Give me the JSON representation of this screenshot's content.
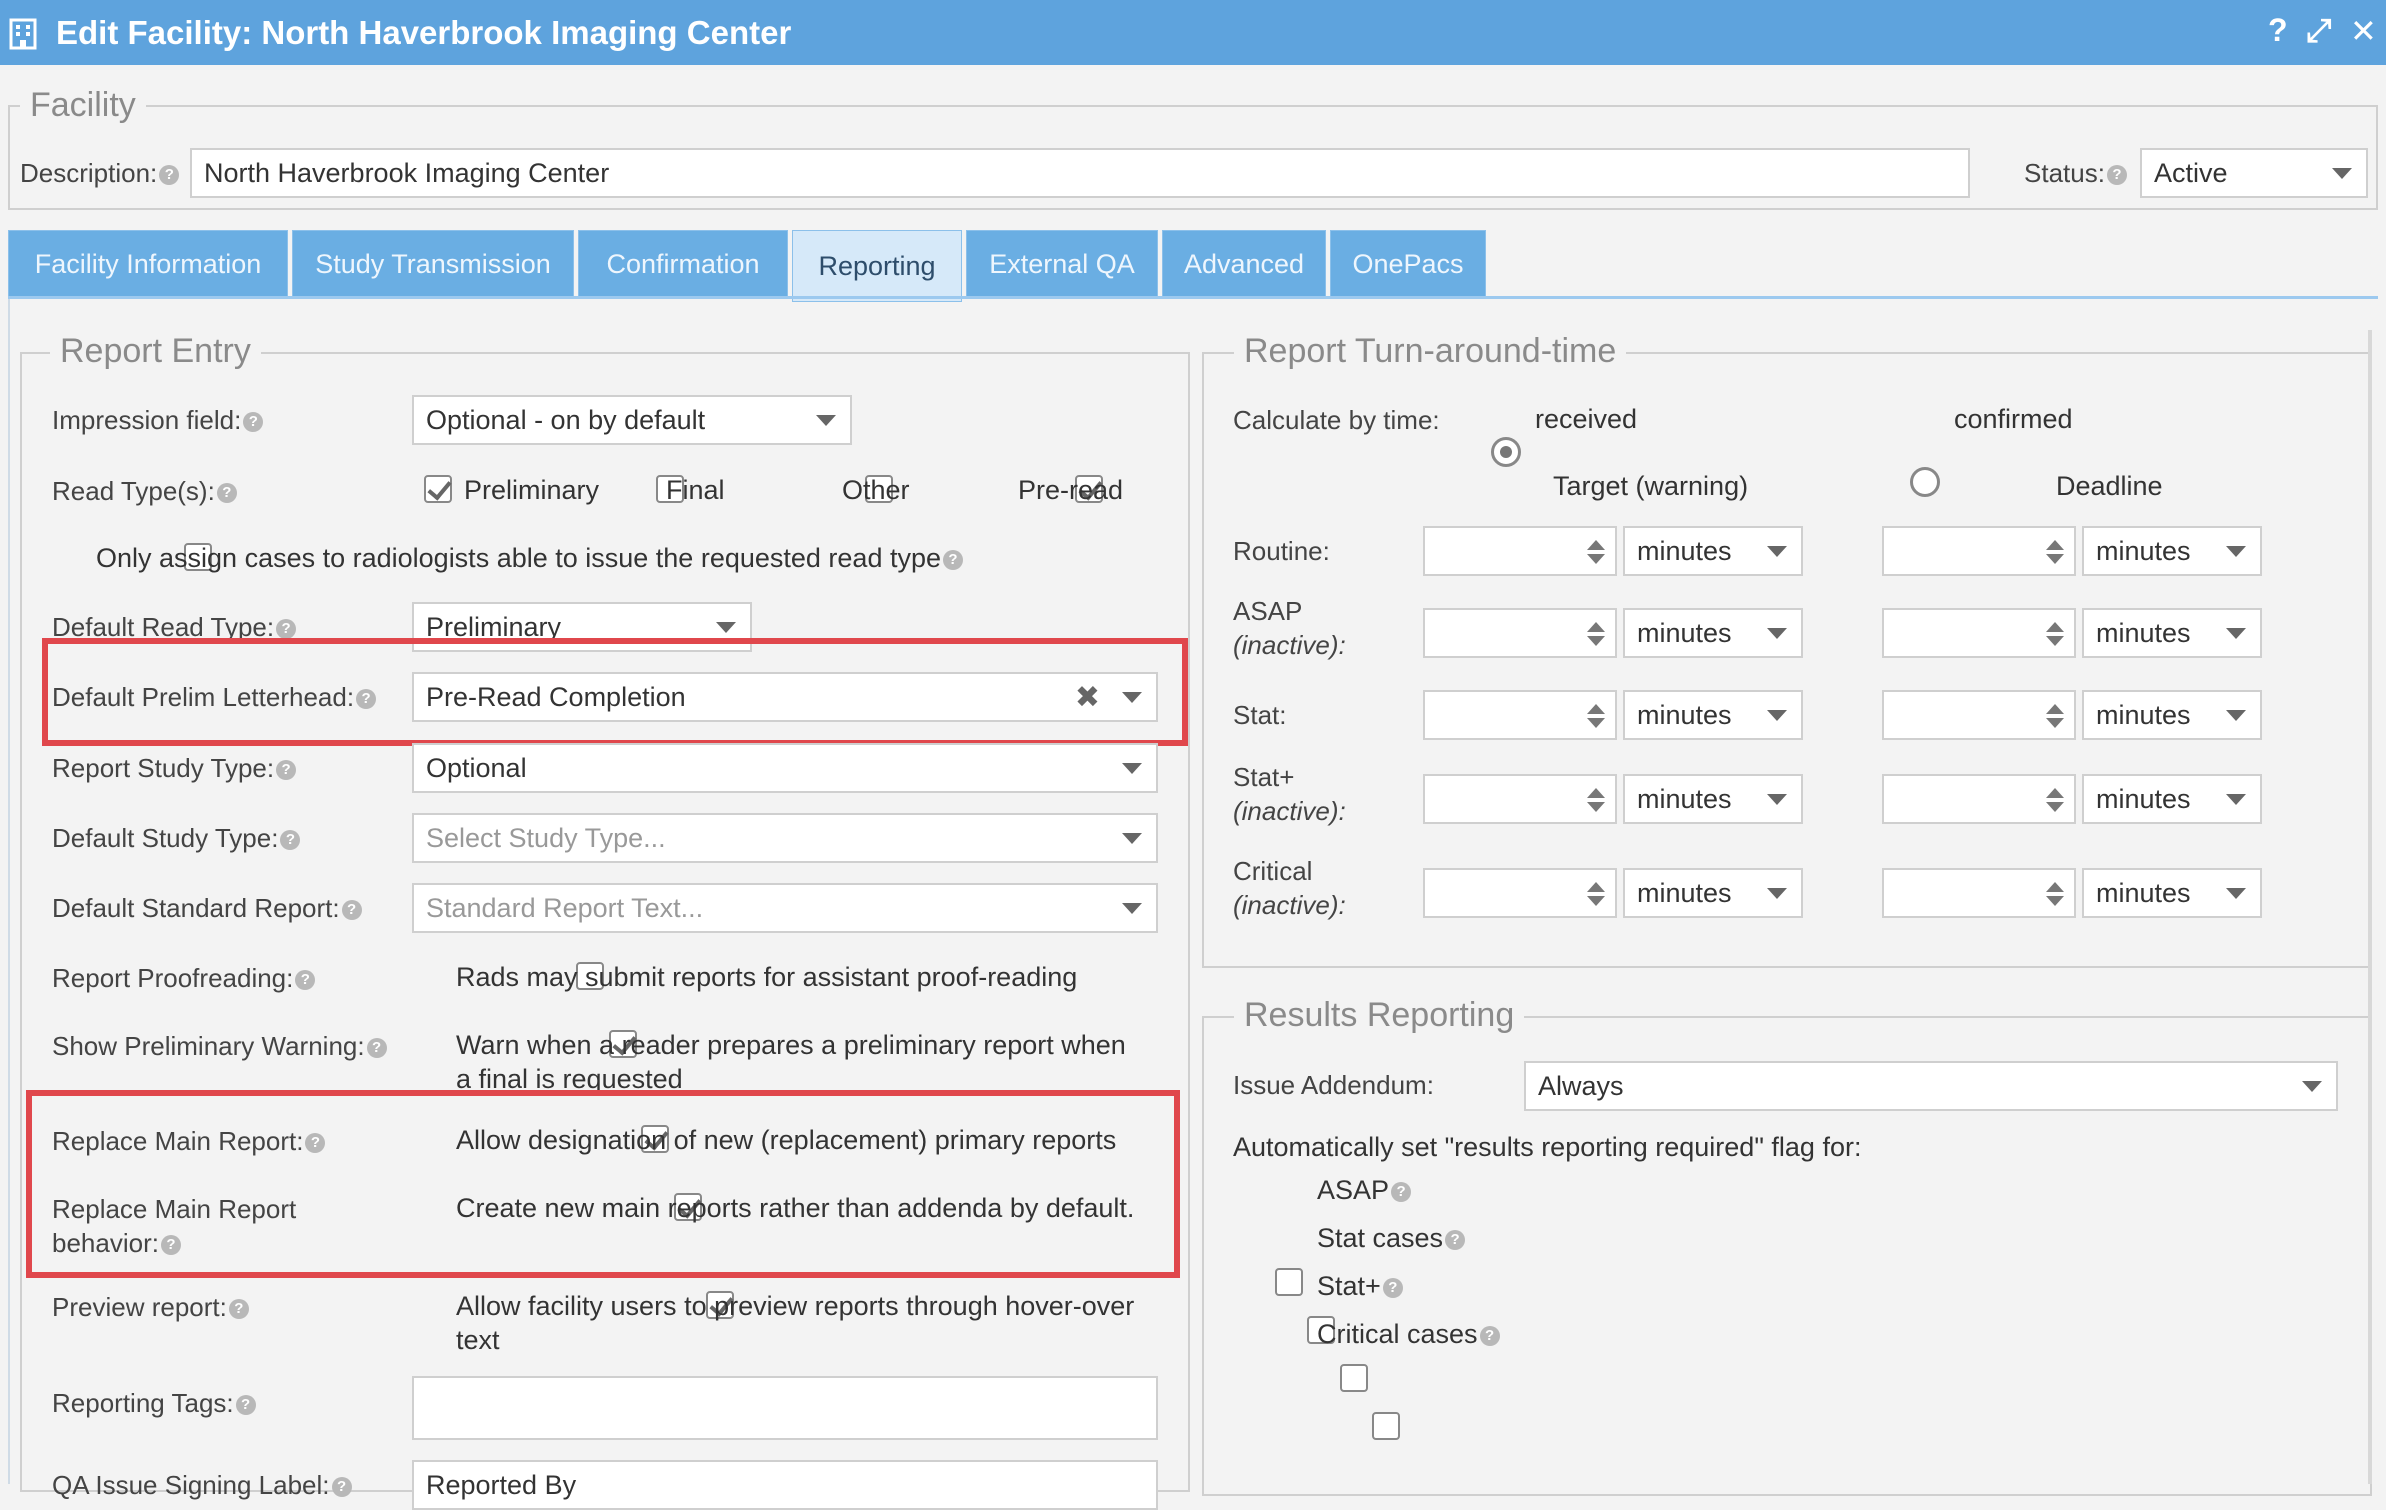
{
  "window": {
    "title": "Edit Facility: North Haverbrook Imaging Center",
    "help": "?",
    "maximize": "⤢",
    "close": "✕"
  },
  "facility": {
    "legend": "Facility",
    "description_label": "Description:",
    "description_value": "North Haverbrook Imaging Center",
    "status_label": "Status:",
    "status_value": "Active"
  },
  "tabs": [
    {
      "label": "Facility Information"
    },
    {
      "label": "Study Transmission"
    },
    {
      "label": "Confirmation"
    },
    {
      "label": "Reporting"
    },
    {
      "label": "External QA"
    },
    {
      "label": "Advanced"
    },
    {
      "label": "OnePacs"
    }
  ],
  "report_entry": {
    "legend": "Report Entry",
    "impression_label": "Impression field:",
    "impression_value": "Optional - on by default",
    "read_types_label": "Read Type(s):",
    "read_types": [
      {
        "label": "Preliminary",
        "checked": true
      },
      {
        "label": "Final",
        "checked": false
      },
      {
        "label": "Other",
        "checked": false
      },
      {
        "label": "Pre-read",
        "checked": true
      }
    ],
    "only_assign_label": "Only assign cases to radiologists able to issue the requested read type",
    "default_read_type_label": "Default Read Type:",
    "default_read_type_value": "Preliminary",
    "default_prelim_letterhead_label": "Default Prelim Letterhead:",
    "default_prelim_letterhead_value": "Pre-Read Completion",
    "report_study_type_label": "Report Study Type:",
    "report_study_type_value": "Optional",
    "default_study_type_label": "Default Study Type:",
    "default_study_type_placeholder": "Select Study Type...",
    "default_standard_report_label": "Default Standard Report:",
    "default_standard_report_placeholder": "Standard Report Text...",
    "report_proofreading_label": "Report Proofreading:",
    "report_proofreading_text": "Rads may submit reports for assistant proof-reading",
    "show_prelim_warning_label": "Show Preliminary Warning:",
    "show_prelim_warning_text1": "Warn when a reader prepares a preliminary report when",
    "show_prelim_warning_text2": "a final is requested",
    "replace_main_label": "Replace Main Report:",
    "replace_main_text": "Allow designation of new (replacement) primary reports",
    "replace_behavior_label1": "Replace Main Report",
    "replace_behavior_label2": "behavior:",
    "replace_behavior_text": "Create new main reports rather than addenda by default.",
    "preview_label": "Preview report:",
    "preview_text1": "Allow facility users to preview reports through hover-over",
    "preview_text2": "text",
    "reporting_tags_label": "Reporting Tags:",
    "qa_signing_label": "QA Issue Signing Label:",
    "qa_signing_value": "Reported By"
  },
  "turnaround": {
    "legend": "Report Turn-around-time",
    "calc_label": "Calculate by time:",
    "received_label": "received",
    "confirmed_label": "confirmed",
    "target_header": "Target (warning)",
    "deadline_header": "Deadline",
    "unit": "minutes",
    "rows": [
      {
        "label": "Routine:",
        "sub": ""
      },
      {
        "label": "ASAP",
        "sub": "(inactive):"
      },
      {
        "label": "Stat:",
        "sub": ""
      },
      {
        "label": "Stat+",
        "sub": "(inactive):"
      },
      {
        "label": "Critical",
        "sub": "(inactive):"
      }
    ]
  },
  "results": {
    "legend": "Results Reporting",
    "issue_addendum_label": "Issue Addendum:",
    "issue_addendum_value": "Always",
    "auto_flag_label": "Automatically set \"results reporting required\" flag for:",
    "flags": [
      {
        "label": "ASAP"
      },
      {
        "label": "Stat cases"
      },
      {
        "label": "Stat+"
      },
      {
        "label": "Critical cases"
      }
    ]
  },
  "colors": {
    "titlebar": "#5ea3dd",
    "tab": "#6aaee3",
    "tab_active": "#d6e9f9",
    "highlight": "#e0474c"
  },
  "icons": {
    "app": "building-icon",
    "help": "question-mark-icon",
    "dropdown": "chevron-down-icon",
    "clear": "clear-x-icon",
    "spinner": "spinner-arrows-icon"
  }
}
